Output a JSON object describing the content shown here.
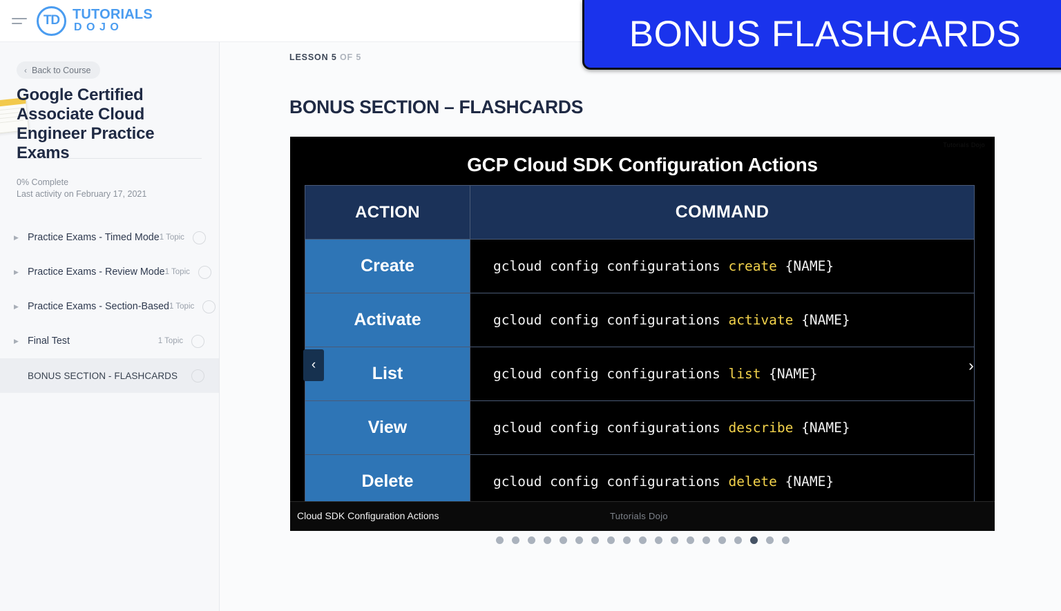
{
  "topbar": {
    "menu_icon": "hamburger-icon",
    "brand_badge": "TD",
    "brand_line1": "TUTORIALS",
    "brand_line2": "DOJO"
  },
  "banner": {
    "label": "BONUS FLASHCARDS",
    "background": "#1a33ec",
    "text_color": "#ffffff"
  },
  "sidebar": {
    "back_button": {
      "label": "Back to Course",
      "chevron": "‹"
    },
    "course_title": "Google Certified Associate Cloud Engineer Practice Exams",
    "progress_percent": "0% Complete",
    "last_activity": "Last activity on February 17, 2021",
    "items": [
      {
        "label": "Practice Exams - Timed Mode",
        "topics": "1 Topic",
        "selected": false,
        "expandable": true
      },
      {
        "label": "Practice Exams - Review Mode",
        "topics": "1 Topic",
        "selected": false,
        "expandable": true
      },
      {
        "label": "Practice Exams - Section-Based",
        "topics": "1 Topic",
        "selected": false,
        "expandable": true
      },
      {
        "label": "Final Test",
        "topics": "1 Topic",
        "selected": false,
        "expandable": true
      },
      {
        "label": "BONUS SECTION - FLASHCARDS",
        "topics": "",
        "selected": true,
        "expandable": false
      }
    ]
  },
  "main": {
    "lesson_label": "LESSON 5",
    "lesson_of": "OF 5",
    "page_title": "BONUS SECTION – FLASHCARDS"
  },
  "flashcard": {
    "heading": "GCP Cloud SDK Configuration Actions",
    "watermark_top": "Tutorials Dojo",
    "footer_caption": "Cloud SDK Configuration Actions",
    "footer_watermark": "Tutorials Dojo",
    "prev_icon": "‹",
    "next_icon": "›",
    "colors": {
      "header_bg": "#1b3259",
      "action_bg": "#2e75b6",
      "command_bg": "#000000",
      "keyword": "#f2d24b"
    },
    "columns": [
      "ACTION",
      "COMMAND"
    ],
    "rows": [
      {
        "action": "Create",
        "cmd_prefix": "gcloud config configurations ",
        "cmd_keyword": "create",
        "cmd_suffix": " {NAME}"
      },
      {
        "action": "Activate",
        "cmd_prefix": "gcloud config configurations ",
        "cmd_keyword": "activate",
        "cmd_suffix": " {NAME}"
      },
      {
        "action": "List",
        "cmd_prefix": "gcloud config configurations ",
        "cmd_keyword": "list",
        "cmd_suffix": " {NAME}"
      },
      {
        "action": "View",
        "cmd_prefix": "gcloud config configurations ",
        "cmd_keyword": "describe",
        "cmd_suffix": " {NAME}"
      },
      {
        "action": "Delete",
        "cmd_prefix": "gcloud config configurations ",
        "cmd_keyword": "delete",
        "cmd_suffix": " {NAME}"
      }
    ]
  },
  "carousel": {
    "total": 19,
    "active_index": 16
  }
}
